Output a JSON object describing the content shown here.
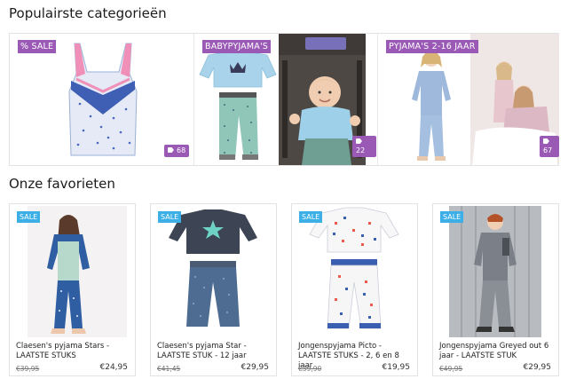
{
  "sections": {
    "categories_title": "Populairste categorieën",
    "favorites_title": "Onze favorieten"
  },
  "categories": [
    {
      "label": "% SALE",
      "count": "68"
    },
    {
      "label": "BABYPYJAMA'S",
      "count": "22"
    },
    {
      "label": "PYJAMA'S 2-16 JAAR",
      "count": "67"
    }
  ],
  "products": [
    {
      "badge": "SALE",
      "title": "Claesen's pyjama Stars - LAATSTE STUKS",
      "old_price": "€39,95",
      "price": "€24,95"
    },
    {
      "badge": "SALE",
      "title": "Claesen's pyjama Star - LAATSTE STUK - 12 jaar",
      "old_price": "€41,45",
      "price": "€29,95"
    },
    {
      "badge": "SALE",
      "title": "Jongenspyjama Picto - LAATSTE STUKS - 2, 6 en 8 jaar",
      "old_price": "€39,90",
      "price": "€19,95"
    },
    {
      "badge": "SALE",
      "title": "Jongenspyjama Greyed out 6 jaar - LAATSTE STUK",
      "old_price": "€49,95",
      "price": "€29,95"
    }
  ],
  "colors": {
    "category_badge": "#9b59b6",
    "sale_badge": "#3bafe6"
  }
}
